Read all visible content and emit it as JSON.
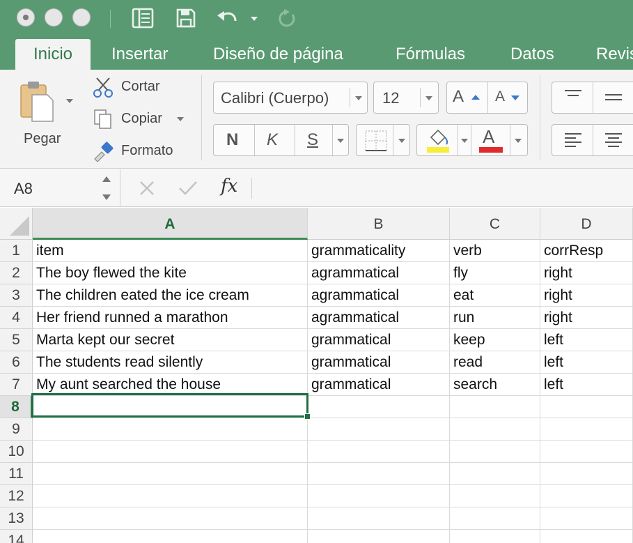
{
  "ribbon_tabs": [
    "Inicio",
    "Insertar",
    "Diseño de página",
    "Fórmulas",
    "Datos",
    "Revis"
  ],
  "active_tab": "Inicio",
  "clipboard": {
    "paste": "Pegar",
    "cut": "Cortar",
    "copy": "Copiar",
    "format": "Formato"
  },
  "font": {
    "name": "Calibri (Cuerpo)",
    "size": "12",
    "bold": "N",
    "italic": "K",
    "underline": "S",
    "grow": "A",
    "shrink": "A",
    "font_color": "A"
  },
  "formula_bar": {
    "name_box": "A8",
    "fx": "fx",
    "value": ""
  },
  "columns": [
    "A",
    "B",
    "C",
    "D"
  ],
  "row_numbers": [
    "1",
    "2",
    "3",
    "4",
    "5",
    "6",
    "7",
    "8",
    "9",
    "10",
    "11",
    "12",
    "13",
    "14"
  ],
  "selected_cell": "A8",
  "rows": [
    [
      "item",
      "grammaticality",
      "verb",
      "corrResp"
    ],
    [
      "The boy flewed the kite",
      "agrammatical",
      "fly",
      "right"
    ],
    [
      "The children eated the ice cream",
      "agrammatical",
      "eat",
      "right"
    ],
    [
      "Her friend runned a marathon",
      "agrammatical",
      "run",
      "right"
    ],
    [
      "Marta kept our secret",
      "grammatical",
      "keep",
      "left"
    ],
    [
      "The students read silently",
      "grammatical",
      "read",
      "left"
    ],
    [
      "My aunt searched the house",
      "grammatical",
      "search",
      "left"
    ]
  ],
  "colors": {
    "titlebar": "#5a9a72",
    "accent": "#1e7045",
    "highlight_yellow": "#f7ee3b",
    "font_red": "#e02b2b"
  }
}
